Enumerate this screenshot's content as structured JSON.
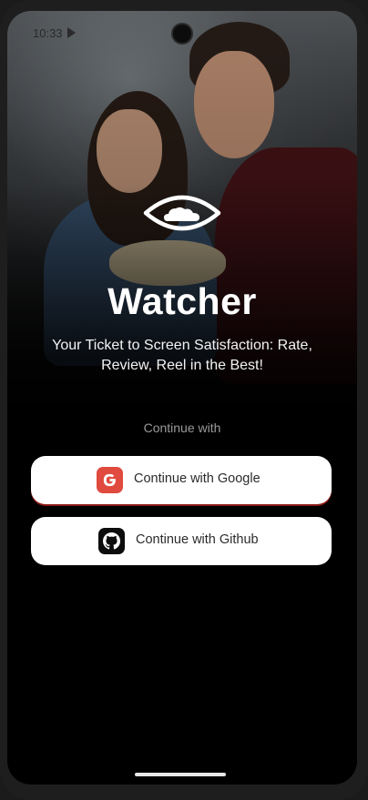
{
  "status_bar": {
    "time": "10:33"
  },
  "app": {
    "title": "Watcher",
    "tagline": "Your Ticket to Screen Satisfaction: Rate, Review, Reel in the Best!"
  },
  "auth": {
    "continue_label": "Continue with",
    "google_button": "Continue with Google",
    "github_button": "Continue with Github"
  },
  "icons": {
    "logo": "eye-cloud-icon",
    "google": "google-icon",
    "github": "github-icon",
    "status": "play-store-icon"
  },
  "colors": {
    "background": "#000000",
    "button_bg": "#ffffff",
    "google_red": "#e04a3f",
    "github_black": "#0d0d0d"
  }
}
